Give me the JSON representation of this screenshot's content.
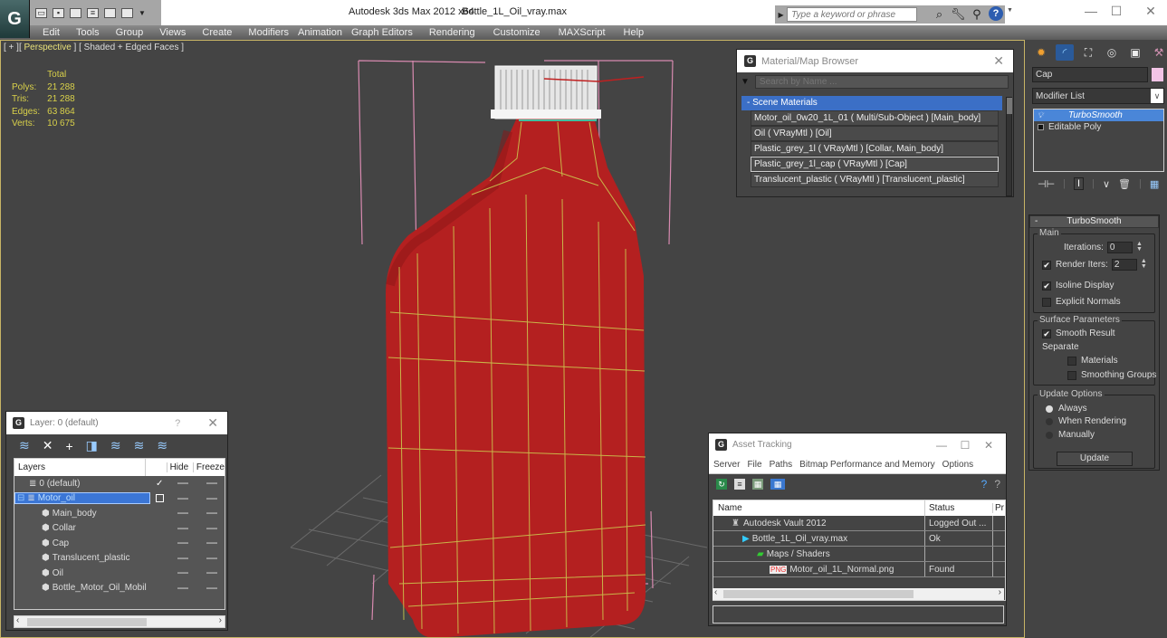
{
  "window": {
    "app_title": "Autodesk 3ds Max  2012 x64",
    "file_title": "Bottle_1L_Oil_vray.max",
    "search_placeholder": "Type a keyword or phrase",
    "minimize": "—",
    "maximize": "☐",
    "close": "✕"
  },
  "quick_access": [
    "new-icon",
    "open-icon",
    "save-icon",
    "hold-icon",
    "fetch-icon",
    "undo-icon",
    "redo-icon"
  ],
  "menu": [
    "Edit",
    "Tools",
    "Group",
    "Views",
    "Create",
    "Modifiers",
    "Animation",
    "Graph Editors",
    "Rendering",
    "Customize",
    "MAXScript",
    "Help"
  ],
  "viewport": {
    "label_plus": "[ + ]",
    "label_view": "Perspective",
    "label_shading": "[ Shaded + Edged Faces ]",
    "stats_header": "Total",
    "stats": [
      {
        "label": "Polys:",
        "value": "21 288"
      },
      {
        "label": "Tris:",
        "value": "21 288"
      },
      {
        "label": "Edges:",
        "value": "63 864"
      },
      {
        "label": "Verts:",
        "value": "10 675"
      }
    ],
    "object_color": "#b22222",
    "wire_color": "#d4d44a"
  },
  "material_browser": {
    "title": "Material/Map Browser",
    "search_placeholder": "Search by Name ...",
    "group": "- Scene Materials",
    "items": [
      {
        "label": "Motor_oil_0w20_1L_01  ( Multi/Sub-Object ) [Main_body]",
        "selected": false
      },
      {
        "label": "Oil  ( VRayMtl ) [Oil]",
        "selected": false
      },
      {
        "label": "Plastic_grey_1l  ( VRayMtl ) [Collar, Main_body]",
        "selected": false
      },
      {
        "label": "Plastic_grey_1l_cap  ( VRayMtl ) [Cap]",
        "selected": true
      },
      {
        "label": "Translucent_plastic  ( VRayMtl ) [Translucent_plastic]",
        "selected": false
      }
    ]
  },
  "command_panel": {
    "object_name": "Cap",
    "object_color": "#f2c4e6",
    "modifier_list": "Modifier List",
    "stack": [
      {
        "label": "TurboSmooth",
        "selected": true
      },
      {
        "label": "Editable Poly",
        "selected": false
      }
    ],
    "turbosmooth": {
      "title": "TurboSmooth",
      "main_group": "Main",
      "iterations_label": "Iterations:",
      "iterations_value": "0",
      "render_iters_label": "Render Iters:",
      "render_iters_value": "2",
      "render_iters_checked": true,
      "isoline_label": "Isoline Display",
      "isoline_checked": true,
      "explicit_normals_label": "Explicit Normals",
      "explicit_normals_checked": false,
      "surface_group": "Surface Parameters",
      "smooth_result_label": "Smooth Result",
      "smooth_result_checked": true,
      "separate_label": "Separate",
      "materials_label": "Materials",
      "smoothing_groups_label": "Smoothing Groups",
      "update_group": "Update Options",
      "always_label": "Always",
      "when_rendering_label": "When Rendering",
      "manually_label": "Manually",
      "update_selected": "Always",
      "update_button": "Update"
    }
  },
  "layer_panel": {
    "title": "Layer: 0 (default)",
    "help": "?",
    "close": "✕",
    "col_layers": "Layers",
    "col_hide": "Hide",
    "col_freeze": "Freeze",
    "rows": [
      {
        "label": "0 (default)",
        "type": "layer",
        "current": true,
        "selected": false
      },
      {
        "label": "Motor_oil",
        "type": "layer",
        "current": false,
        "selected": true
      },
      {
        "label": "Main_body",
        "type": "object",
        "selected": false
      },
      {
        "label": "Collar",
        "type": "object",
        "selected": false
      },
      {
        "label": "Cap",
        "type": "object",
        "selected": false
      },
      {
        "label": "Translucent_plastic",
        "type": "object",
        "selected": false
      },
      {
        "label": "Oil",
        "type": "object",
        "selected": false
      },
      {
        "label": "Bottle_Motor_Oil_Mobil",
        "type": "object",
        "selected": false
      }
    ]
  },
  "asset_tracking": {
    "title": "Asset Tracking",
    "menu": [
      "Server",
      "File",
      "Paths",
      "Bitmap Performance and Memory",
      "Options"
    ],
    "col_name": "Name",
    "col_status": "Status",
    "col_extra": "Pr",
    "rows": [
      {
        "name": "Autodesk Vault 2012",
        "status": "Logged Out ...",
        "indent": 1,
        "icon": "vault-icon"
      },
      {
        "name": "Bottle_1L_Oil_vray.max",
        "status": "Ok",
        "indent": 2,
        "icon": "max-file-icon"
      },
      {
        "name": "Maps / Shaders",
        "status": "",
        "indent": 3,
        "icon": "maps-icon"
      },
      {
        "name": "Motor_oil_1L_Normal.png",
        "status": "Found",
        "indent": 4,
        "icon": "png-icon"
      }
    ]
  }
}
